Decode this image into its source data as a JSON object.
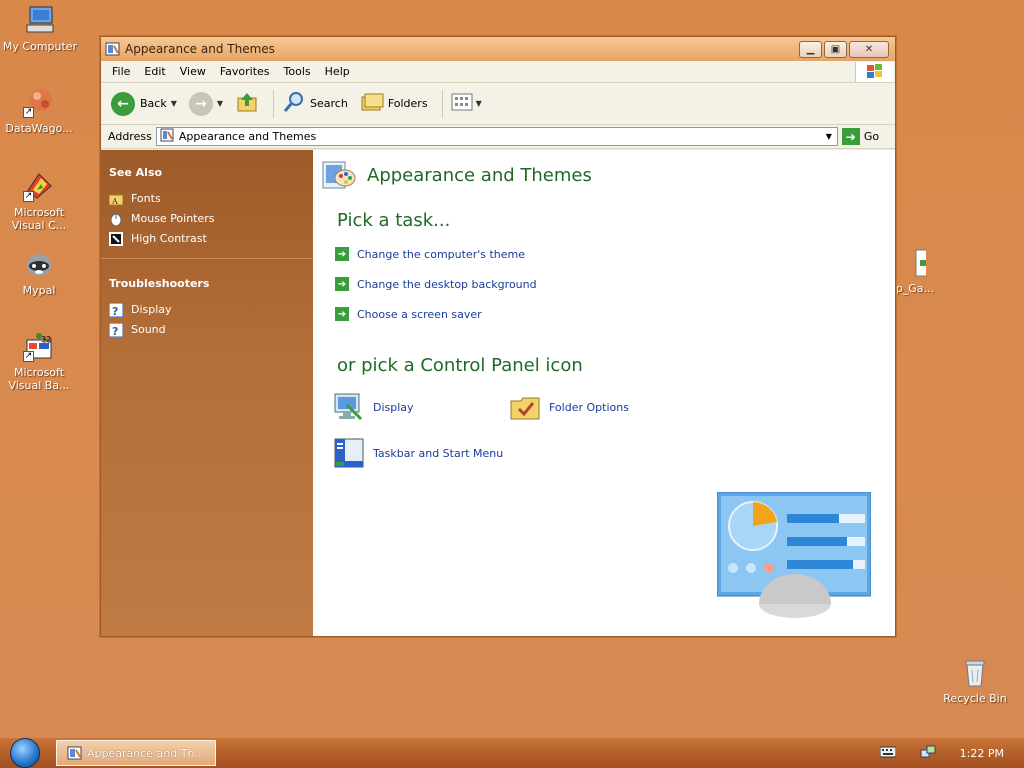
{
  "desktop": {
    "icons": [
      {
        "label": "My Computer"
      },
      {
        "label": "DataWago..."
      },
      {
        "label": "Microsoft Visual C..."
      },
      {
        "label": "Mypal"
      },
      {
        "label": "Microsoft Visual Ba..."
      },
      {
        "label": "p_Ga..."
      },
      {
        "label": "Recycle Bin"
      }
    ]
  },
  "window": {
    "title": "Appearance and Themes",
    "menu": [
      "File",
      "Edit",
      "View",
      "Favorites",
      "Tools",
      "Help"
    ],
    "toolbar": {
      "back": "Back",
      "search": "Search",
      "folders": "Folders"
    },
    "address": {
      "label": "Address",
      "value": "Appearance and Themes",
      "go": "Go"
    },
    "sidepane": {
      "see_also": {
        "heading": "See Also",
        "items": [
          "Fonts",
          "Mouse Pointers",
          "High Contrast"
        ]
      },
      "troubleshooters": {
        "heading": "Troubleshooters",
        "items": [
          "Display",
          "Sound"
        ]
      }
    },
    "main": {
      "title": "Appearance and Themes",
      "pick_task": "Pick a task...",
      "tasks": [
        "Change the computer's theme",
        "Change the desktop background",
        "Choose a screen saver"
      ],
      "pick_icon": "or pick a Control Panel icon",
      "icons": [
        "Display",
        "Folder Options",
        "Taskbar and Start Menu"
      ]
    }
  },
  "taskbar": {
    "window_button": "Appearance and Th...",
    "clock": "1:22 PM"
  },
  "colors": {
    "accent_green": "#1f6a27",
    "link_blue": "#1a3b9c",
    "sidepane": "#b36d37"
  }
}
